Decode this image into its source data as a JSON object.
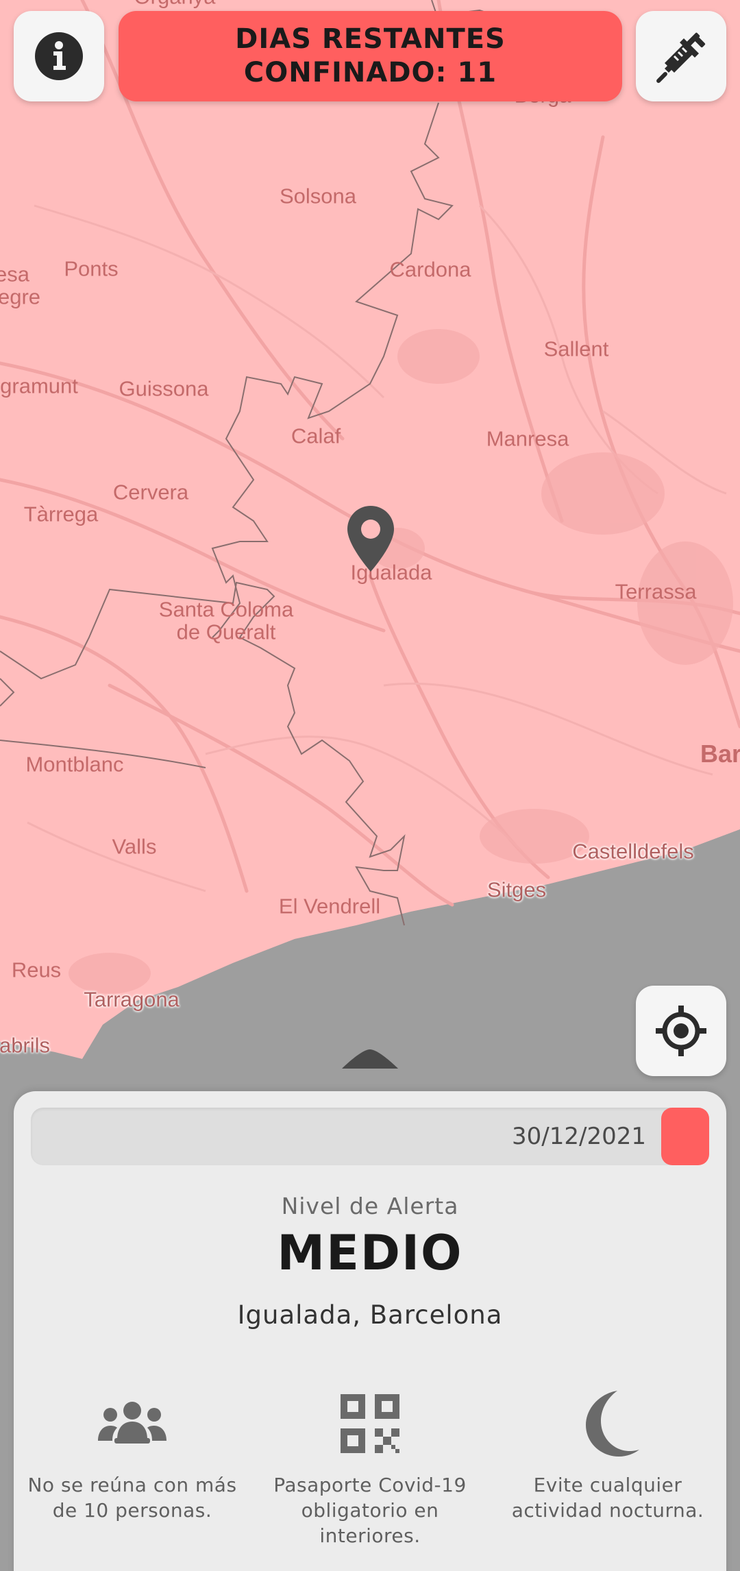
{
  "header": {
    "info_icon": "info-icon",
    "banner_line1": "DIAS RESTANTES",
    "banner_line2": "CONFINADO: 11",
    "vaccine_icon": "syringe-icon"
  },
  "map": {
    "tint_color": "#ffbdbd",
    "sea_color": "#9e9e9e",
    "labels": [
      {
        "id": "solsona",
        "text": "Solsona"
      },
      {
        "id": "ponts",
        "text": "Ponts"
      },
      {
        "id": "esa",
        "text": "esa"
      },
      {
        "id": "egre",
        "text": "egre"
      },
      {
        "id": "cardona",
        "text": "Cardona"
      },
      {
        "id": "sallent",
        "text": "Sallent"
      },
      {
        "id": "gramunt",
        "text": "gramunt"
      },
      {
        "id": "guissona",
        "text": "Guissona"
      },
      {
        "id": "calaf",
        "text": "Calaf"
      },
      {
        "id": "manresa",
        "text": "Manresa"
      },
      {
        "id": "cervera",
        "text": "Cervera"
      },
      {
        "id": "tarrega",
        "text": "Tàrrega"
      },
      {
        "id": "igualada",
        "text": "Igualada"
      },
      {
        "id": "terrassa",
        "text": "Terrassa"
      },
      {
        "id": "santa_coloma_1",
        "text": "Santa Coloma"
      },
      {
        "id": "santa_coloma_2",
        "text": "de Queralt"
      },
      {
        "id": "montblanc",
        "text": "Montblanc"
      },
      {
        "id": "bar",
        "text": "Bar"
      },
      {
        "id": "valls",
        "text": "Valls"
      },
      {
        "id": "castelldefels",
        "text": "Castelldefels"
      },
      {
        "id": "sitges",
        "text": "Sitges"
      },
      {
        "id": "el_vendrell",
        "text": "El Vendrell"
      },
      {
        "id": "reus",
        "text": "Reus"
      },
      {
        "id": "tarragona",
        "text": "Tarragona"
      },
      {
        "id": "abrils",
        "text": "abrils"
      },
      {
        "id": "berga",
        "text": "Berga"
      },
      {
        "id": "organya",
        "text": "Organyà"
      }
    ],
    "pin_icon": "map-pin-icon",
    "locate_icon": "crosshair-icon"
  },
  "panel": {
    "date": "30/12/2021",
    "alert_label": "Nivel de Alerta",
    "alert_level": "MEDIO",
    "location": "Igualada, Barcelona",
    "accent_color": "#ff5f5f",
    "rules": [
      {
        "icon": "group-icon",
        "text": "No se reúna con más de 10 personas."
      },
      {
        "icon": "qr-code-icon",
        "text": "Pasaporte Covid-19 obligatorio en interiores."
      },
      {
        "icon": "moon-icon",
        "text": "Evite cualquier actividad nocturna."
      }
    ]
  }
}
